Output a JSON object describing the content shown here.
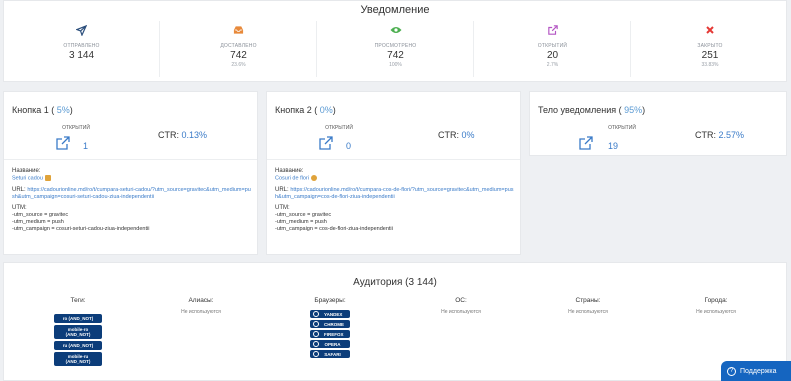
{
  "stats": {
    "title": "Уведомление",
    "items": [
      {
        "icon": "paper-plane-icon",
        "label": "Отправлено",
        "value": "3 144",
        "pct": ""
      },
      {
        "icon": "inbox-icon",
        "label": "Доставлено",
        "value": "742",
        "pct": "23.6%"
      },
      {
        "icon": "eye-icon",
        "label": "Просмотрено",
        "value": "742",
        "pct": "100%"
      },
      {
        "icon": "external-link-icon",
        "label": "Открытий",
        "value": "20",
        "pct": "2.7%"
      },
      {
        "icon": "close-x-icon",
        "label": "Закрыто",
        "value": "251",
        "pct": "33.83%"
      }
    ]
  },
  "button1": {
    "title": "Кнопка 1",
    "percent": "5%",
    "opened_label": "Открытий",
    "count": "1",
    "ctr_label": "CTR:",
    "ctr_value": "0.13%",
    "name_label": "Название:",
    "name_value": "Seturi cadou",
    "url_label": "URL:",
    "url_value": "https://cadourionline.md/ro/t/cumpara-seturi-cadou/?utm_source=gravitec&utm_medium=push&utm_campaign=cosuri-seturi-cadou-ziua-independentii",
    "utm_label": "UTM:",
    "utm_lines": [
      "-utm_source = gravitec",
      "-utm_medium = push",
      "-utm_campaign = cosuri-seturi-cadou-ziua-independentii"
    ]
  },
  "button2": {
    "title": "Кнопка 2",
    "percent": "0%",
    "opened_label": "Открытий",
    "count": "0",
    "ctr_label": "CTR:",
    "ctr_value": "0%",
    "name_label": "Название:",
    "name_value": "Cosuri de flori",
    "url_label": "URL:",
    "url_value": "https://cadourionline.md/ro/t/cumpara-cos-de-flori/?utm_source=gravitec&utm_medium=push&utm_campaign=cos-de-flori-ziua-independentii",
    "utm_label": "UTM:",
    "utm_lines": [
      "-utm_source = gravitec",
      "-utm_medium = push",
      "-utm_campaign = cos-de-flori-ziua-independentii"
    ]
  },
  "body_card": {
    "title": "Тело уведомления",
    "percent": "95%",
    "opened_label": "Открытий",
    "count": "19",
    "ctr_label": "CTR:",
    "ctr_value": "2.57%"
  },
  "audience": {
    "title": "Аудитория (3 144)",
    "tags_label": "Теги:",
    "tags": [
      "ro (AND_NOT)",
      "mobile-ro (AND_NOT)",
      "ru (AND_NOT)",
      "mobile-ru (AND_NOT)"
    ],
    "aliases_label": "Алиасы:",
    "aliases_value": "Не используются",
    "browsers_label": "Браузеры:",
    "browsers": [
      "YANDEX",
      "CHROME",
      "FIREFOX",
      "OPERA",
      "SAFARI"
    ],
    "os_label": "ОС:",
    "os_value": "Не используются",
    "countries_label": "Страны:",
    "countries_value": "Не используются",
    "cities_label": "Города:",
    "cities_value": "Не используются"
  },
  "support": {
    "label": "Поддержка"
  },
  "colors": {
    "accent": "#3a7bc8",
    "tag_bg": "#0c3d7a",
    "support_bg": "#1565c0"
  }
}
